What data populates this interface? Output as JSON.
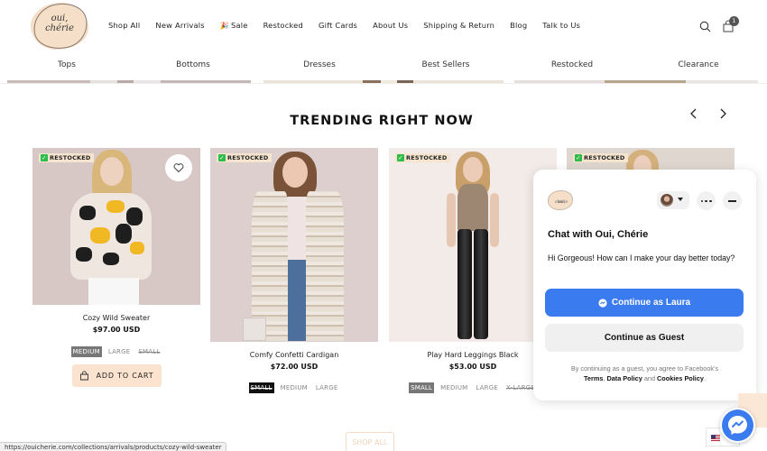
{
  "header": {
    "logo_text_line1": "oui,",
    "logo_text_line2": "chérie",
    "nav": [
      {
        "label": "Shop All"
      },
      {
        "label": "New Arrivals"
      },
      {
        "label": "Sale",
        "emoji": "🎉"
      },
      {
        "label": "Restocked"
      },
      {
        "label": "Gift Cards"
      },
      {
        "label": "About Us"
      },
      {
        "label": "Shipping & Return"
      },
      {
        "label": "Blog"
      },
      {
        "label": "Talk to Us"
      }
    ],
    "search_icon": "search-icon",
    "cart_icon": "shopping-bag-icon",
    "cart_count": "1"
  },
  "subnav": [
    {
      "label": "Tops"
    },
    {
      "label": "Bottoms"
    },
    {
      "label": "Dresses"
    },
    {
      "label": "Best Sellers"
    },
    {
      "label": "Restocked"
    },
    {
      "label": "Clearance"
    }
  ],
  "section": {
    "title": "TRENDING RIGHT NOW",
    "prev_icon": "chevron-left-icon",
    "next_icon": "chevron-right-icon"
  },
  "products": [
    {
      "badge": "RESTOCKED",
      "name": "Cozy Wild Sweater",
      "price": "$97.00 USD",
      "sizes": [
        {
          "label": "MEDIUM",
          "state": "selected"
        },
        {
          "label": "LARGE",
          "state": "available"
        },
        {
          "label": "SMALL",
          "state": "sold-out"
        }
      ],
      "add_to_cart": "ADD TO CART",
      "wishlist_icon": "heart-icon"
    },
    {
      "badge": "RESTOCKED",
      "name": "Comfy Confetti Cardigan",
      "price": "$72.00 USD",
      "sizes": [
        {
          "label": "SMALL",
          "state": "selected-sold-out"
        },
        {
          "label": "MEDIUM",
          "state": "available"
        },
        {
          "label": "LARGE",
          "state": "available"
        }
      ]
    },
    {
      "badge": "RESTOCKED",
      "name": "Play Hard Leggings Black",
      "price": "$53.00 USD",
      "sizes": [
        {
          "label": "SMALL",
          "state": "selected"
        },
        {
          "label": "MEDIUM",
          "state": "available"
        },
        {
          "label": "LARGE",
          "state": "available"
        },
        {
          "label": "X-LARGE",
          "state": "sold-out"
        }
      ]
    },
    {
      "badge": "RESTOCKED"
    }
  ],
  "chat": {
    "logo_text_line1": "oui,",
    "logo_text_line2": "chérie",
    "title": "Chat with Oui, Chérie",
    "message": "Hi Gorgeous! How can I make your day better today?",
    "continue_user": "Continue as Laura",
    "continue_guest": "Continue as Guest",
    "legal_prefix": "By continuing as a guest, you agree to Facebook's",
    "legal_terms": "Terms",
    "legal_sep": ", ",
    "legal_data_policy": "Data Policy",
    "legal_and": " and ",
    "legal_cookies": "Cookies Policy",
    "legal_end": ".",
    "colors": {
      "primary": "#3b7bf0",
      "secondary": "#f0f0f0"
    }
  },
  "bottom": {
    "shop_all": "SHOP ALL",
    "status_url": "https://ouicherie.com/collections/arrivals/products/cozy-wild-sweater"
  },
  "colors": {
    "brand_peach": "#f6dfc8",
    "add_to_cart_bg": "#fbe3cf",
    "restocked_check": "#2ebd4b",
    "messenger_blue": "#3b7bf0"
  }
}
